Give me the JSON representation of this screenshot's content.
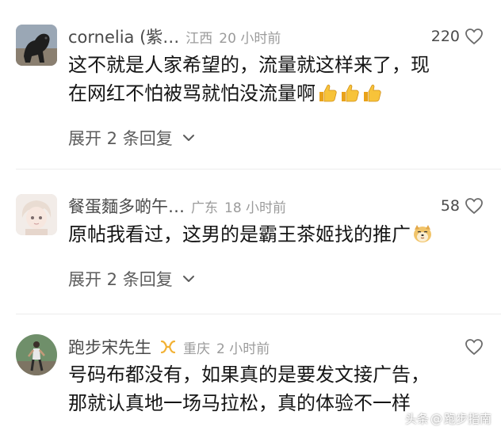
{
  "comments": [
    {
      "username": "cornelia (紫…",
      "location": "江西",
      "time": "20 小时前",
      "likes": "220",
      "text_line1": "这不就是人家希望的，流量就这样来了，现",
      "text_line2": "在网红不怕被骂就怕没流量啊",
      "emojis": [
        "thumbs-up",
        "thumbs-up",
        "thumbs-up"
      ],
      "expand_label": "展开 2 条回复"
    },
    {
      "username": "餐蛋麵多啲午…",
      "location": "广东",
      "time": "18 小时前",
      "likes": "58",
      "text_line1": "原帖我看过，这男的是霸王茶姬找的推广",
      "emojis": [
        "doge"
      ],
      "expand_label": "展开 2 条回复"
    },
    {
      "username": "跑步宋先生",
      "location": "重庆",
      "time": "2 小时前",
      "likes": "",
      "text_line1": "号码布都没有，如果真的是要发文接广告，",
      "text_line2": "那就认真地一场马拉松，真的体验不一样"
    }
  ],
  "watermark": {
    "prefix": "头条",
    "at": "@",
    "account": "跑步指南"
  },
  "colors": {
    "username": "#4a4a4a",
    "meta": "#9b9b9b",
    "badge": "#f2b134"
  }
}
